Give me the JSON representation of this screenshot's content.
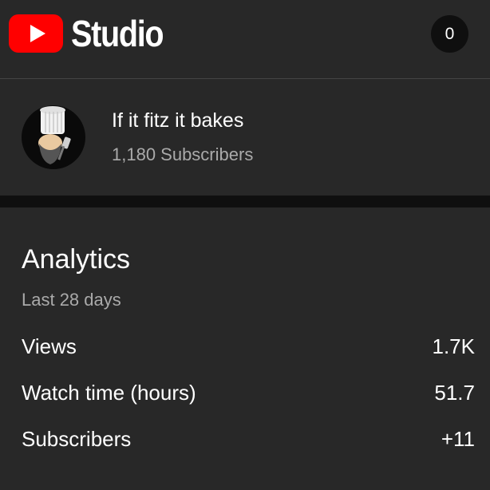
{
  "header": {
    "logo_text": "Studio",
    "logo_icon": "youtube-play-icon",
    "notification_count": "0",
    "brand_color": "#ff0000"
  },
  "channel": {
    "name": "If it fitz it bakes",
    "subscribers": "1,180 Subscribers",
    "avatar_icon": "chef-hat-avatar"
  },
  "analytics": {
    "title": "Analytics",
    "period": "Last 28 days",
    "metrics": [
      {
        "label": "Views",
        "value": "1.7K"
      },
      {
        "label": "Watch time (hours)",
        "value": "51.7"
      },
      {
        "label": "Subscribers",
        "value": "+11"
      }
    ]
  }
}
